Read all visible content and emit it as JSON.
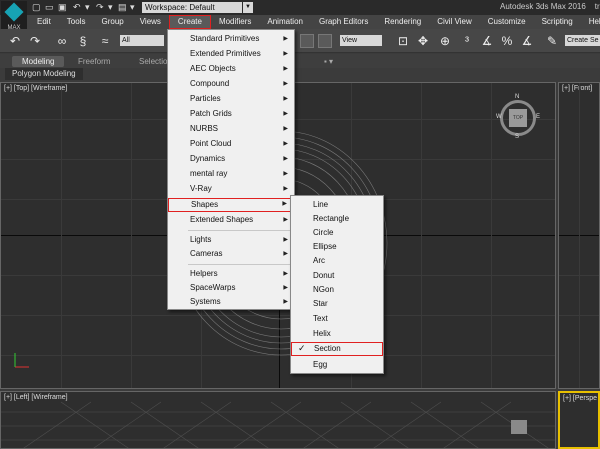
{
  "app": {
    "logo_text": "MAX",
    "workspace": "Workspace: Default",
    "title": "Autodesk 3ds Max 2016",
    "file": "tree_m"
  },
  "menubar": [
    "Edit",
    "Tools",
    "Group",
    "Views",
    "Create",
    "Modifiers",
    "Animation",
    "Graph Editors",
    "Rendering",
    "Civil View",
    "Customize",
    "Scripting",
    "Help"
  ],
  "toolbar": {
    "selection_filter": "All",
    "reference_coord": "View",
    "create_selection_set": "Create Se"
  },
  "ribbon": {
    "tabs": [
      "Modeling",
      "Freeform",
      "Selection"
    ],
    "sub": "Polygon Modeling"
  },
  "viewports": {
    "top": "[+] [Top] [Wireframe]",
    "front": "[+] [Front]",
    "left": "[+] [Left] [Wireframe]",
    "perspective": "[+] [Perspe"
  },
  "viewcube": {
    "face": "TOP",
    "n": "N",
    "w": "W",
    "e": "E",
    "s": "S"
  },
  "create_menu": [
    {
      "label": "Standard Primitives",
      "arrow": "▶"
    },
    {
      "label": "Extended Primitives",
      "arrow": "▶"
    },
    {
      "label": "AEC Objects",
      "arrow": "▶"
    },
    {
      "label": "Compound",
      "arrow": "▶"
    },
    {
      "label": "Particles",
      "arrow": "▶"
    },
    {
      "label": "Patch Grids",
      "arrow": "▶"
    },
    {
      "label": "NURBS",
      "arrow": "▶"
    },
    {
      "label": "Point Cloud",
      "arrow": "▶"
    },
    {
      "label": "Dynamics",
      "arrow": "▶"
    },
    {
      "label": "mental ray",
      "arrow": "▶"
    },
    {
      "label": "V-Ray",
      "arrow": "▶"
    },
    {
      "label": "Shapes",
      "arrow": "▶"
    },
    {
      "label": "Extended Shapes",
      "arrow": "▶"
    },
    {
      "label": "Lights",
      "arrow": "▶"
    },
    {
      "label": "Cameras",
      "arrow": "▶"
    },
    {
      "label": "Helpers",
      "arrow": "▶"
    },
    {
      "label": "SpaceWarps",
      "arrow": "▶"
    },
    {
      "label": "Systems",
      "arrow": "▶"
    }
  ],
  "shapes_menu": [
    "Line",
    "Rectangle",
    "Circle",
    "Ellipse",
    "Arc",
    "Donut",
    "NGon",
    "Star",
    "Text",
    "Helix",
    "Section",
    "Egg"
  ],
  "shapes_check": "✓"
}
